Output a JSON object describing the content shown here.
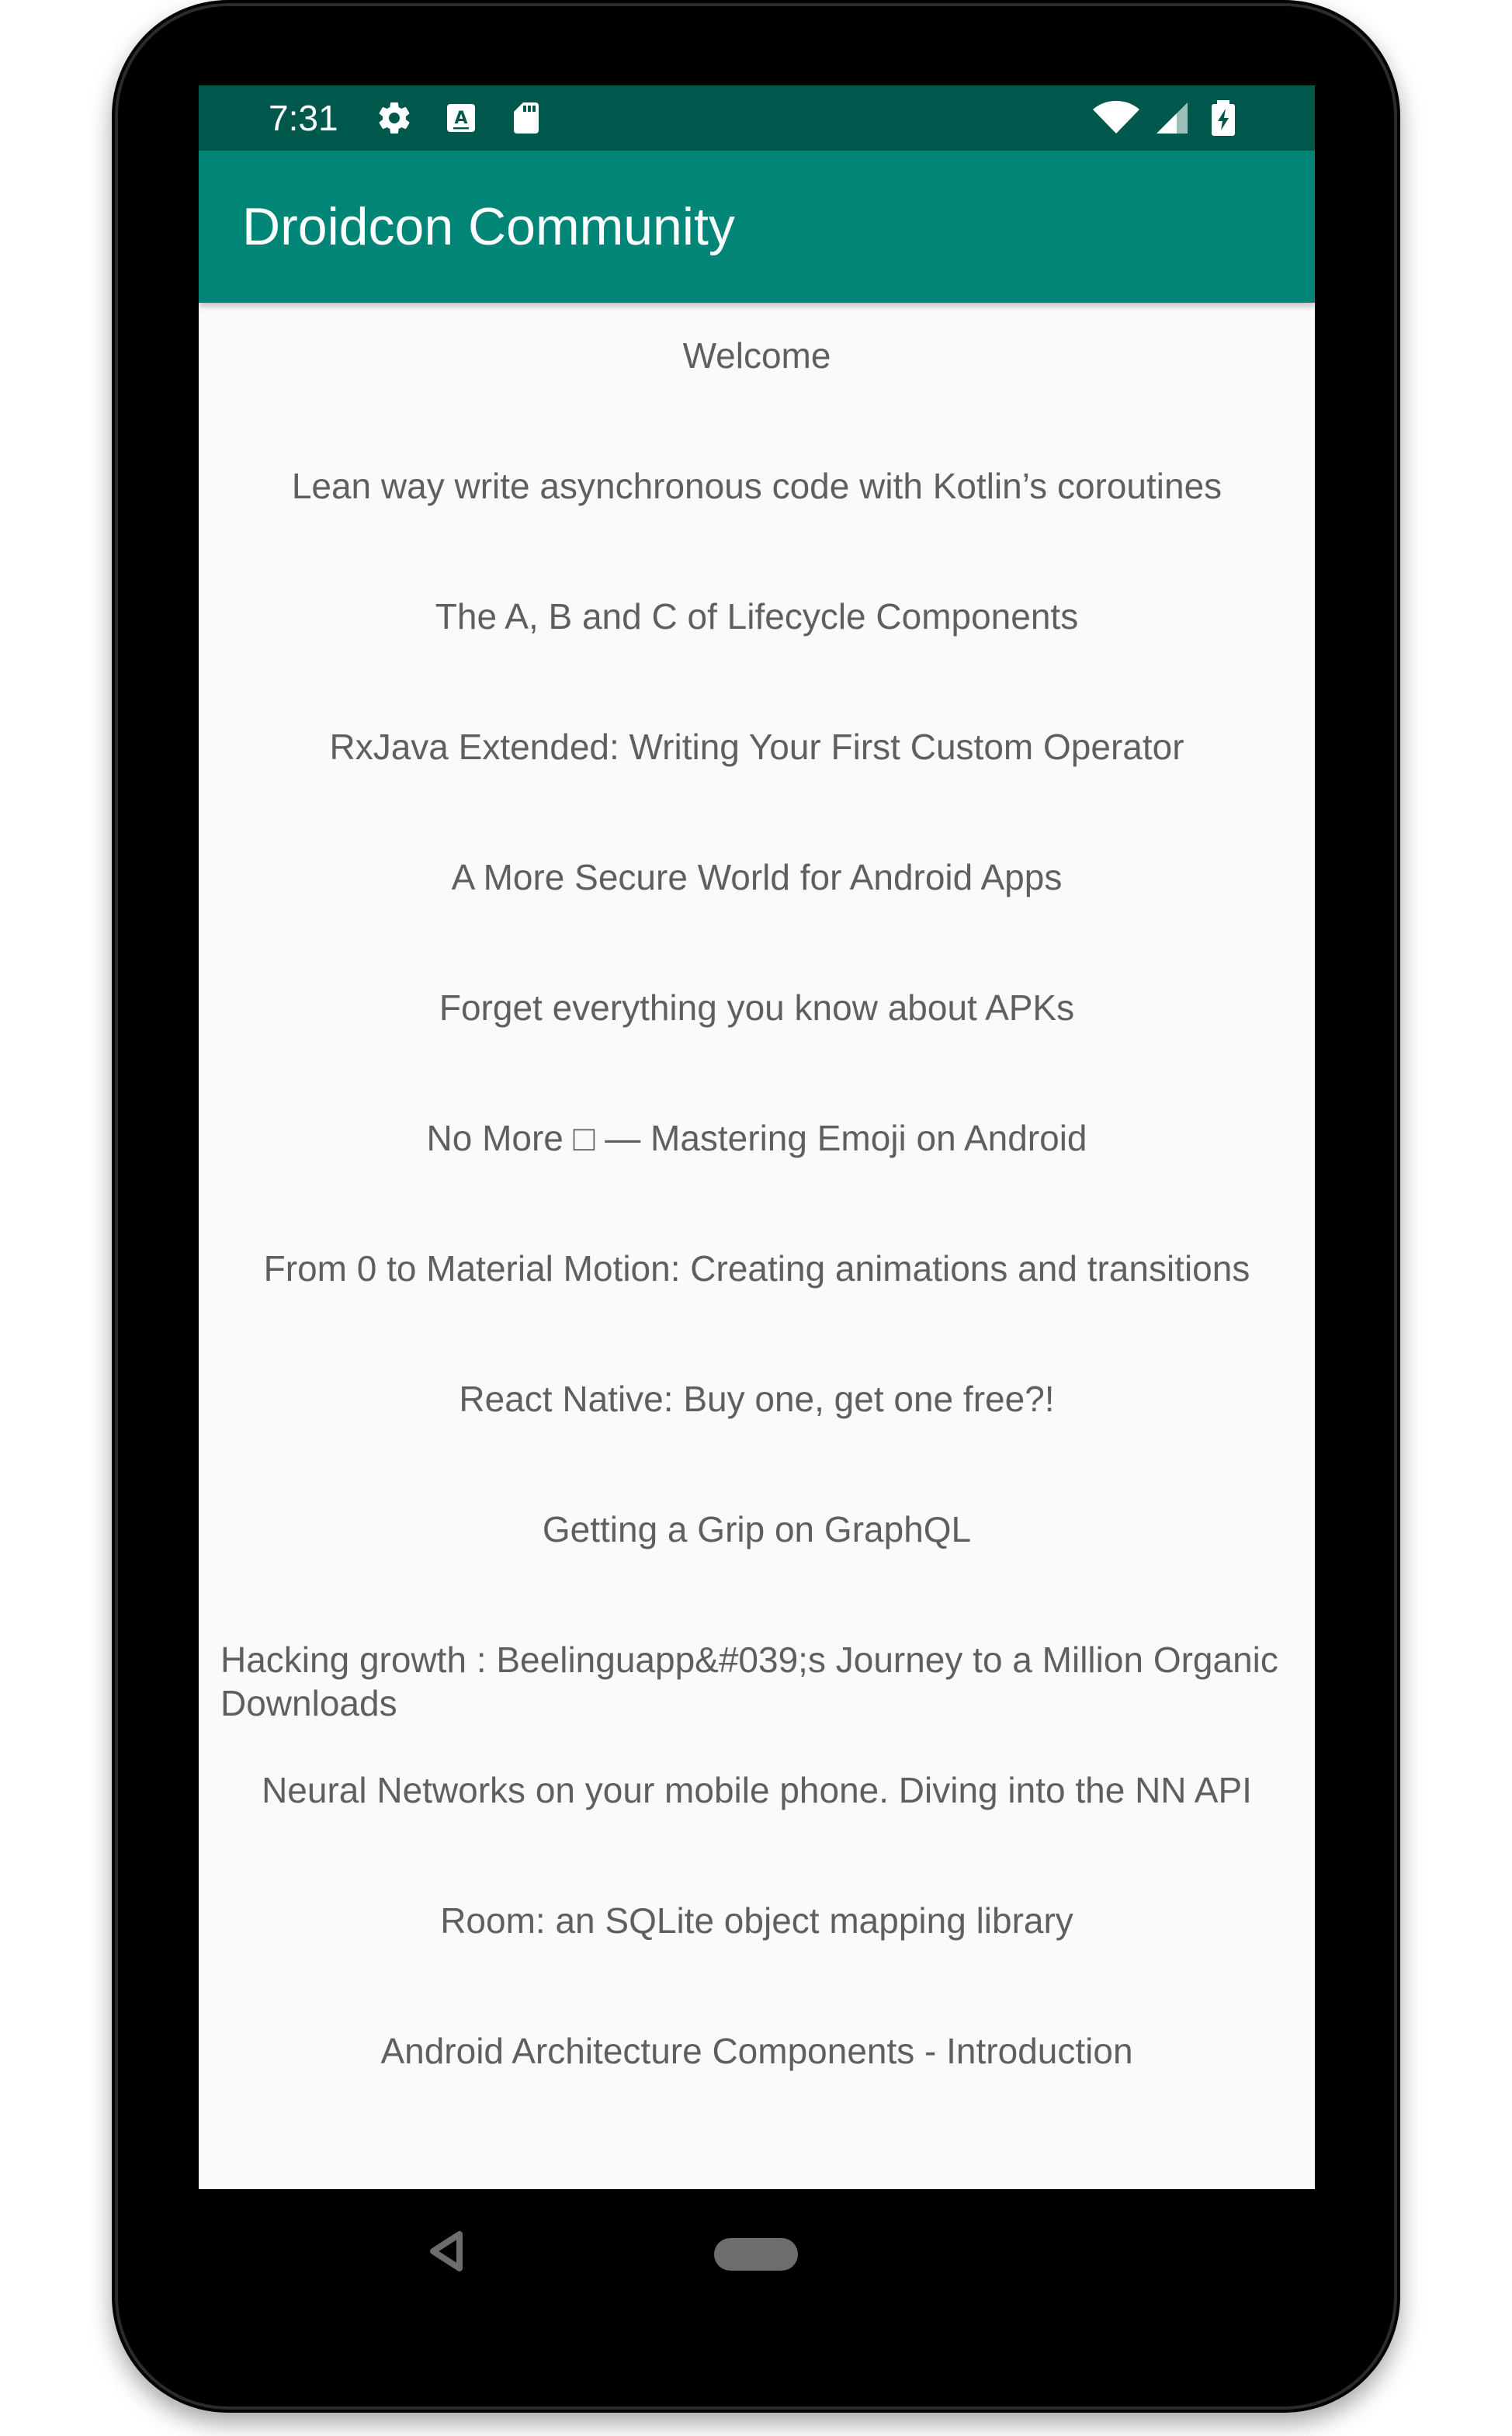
{
  "status_bar": {
    "time": "7:31",
    "icons": [
      "settings-icon",
      "keyboard-icon",
      "sd-card-icon",
      "wifi-icon",
      "signal-icon",
      "battery-charging-icon"
    ]
  },
  "app_bar": {
    "title": "Droidcon Community"
  },
  "talks": [
    "Welcome",
    "Lean way write asynchronous code with Kotlin’s coroutines",
    "The A, B and C of Lifecycle Components",
    "RxJava Extended: Writing Your First Custom Operator",
    "A More Secure World for Android Apps",
    "Forget everything you know about APKs",
    "No More □ — Mastering Emoji on Android",
    "From 0 to Material Motion: Creating animations and transitions",
    "React Native: Buy one, get one free?!",
    "Getting a Grip on GraphQL",
    "Hacking growth : Beelinguapp&#039;s Journey to a Million Organic Downloads",
    "Neural Networks on your mobile phone. Diving into the NN API",
    "Room: an SQLite object mapping library",
    "Android Architecture Components - Introduction"
  ],
  "nav_bar": {
    "buttons": [
      "back-icon",
      "home-icon"
    ]
  },
  "colors": {
    "status_bar": "#00574b",
    "app_bar": "#008577",
    "background": "#fafafa",
    "list_text": "#5f5f5f"
  }
}
